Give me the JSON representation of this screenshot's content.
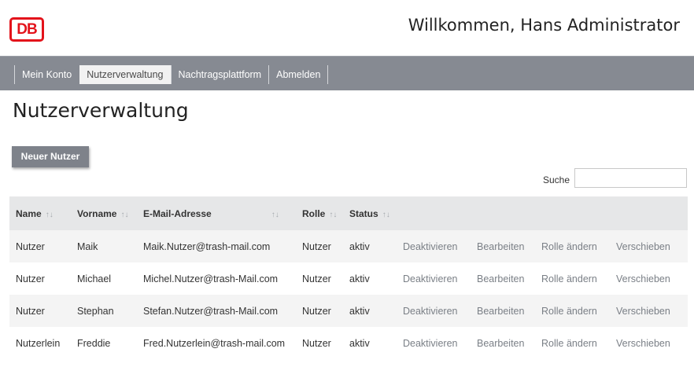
{
  "header": {
    "logo_text": "DB",
    "brand_color": "#e3131b",
    "welcome": "Willkommen, Hans Administrator"
  },
  "nav": {
    "items": [
      {
        "label": "Mein Konto"
      },
      {
        "label": "Nutzerverwaltung",
        "active": true
      },
      {
        "label": "Nachtragsplattform"
      },
      {
        "label": "Abmelden"
      }
    ],
    "background": "#868a92"
  },
  "page": {
    "title": "Nutzerverwaltung",
    "new_user_button": "Neuer Nutzer",
    "search_label": "Suche",
    "search_value": ""
  },
  "table": {
    "columns": [
      "Name",
      "Vorname",
      "E-Mail-Adresse",
      "Rolle",
      "Status"
    ],
    "sort_icon": "sort-arrows-icon",
    "rows": [
      {
        "name": "Nutzer",
        "vorname": "Maik",
        "email": "Maik.Nutzer@trash-mail.com",
        "rolle": "Nutzer",
        "status": "aktiv",
        "actions": [
          "Deaktivieren",
          "Bearbeiten",
          "Rolle ändern",
          "Verschieben"
        ]
      },
      {
        "name": "Nutzer",
        "vorname": "Michael",
        "email": "Michel.Nutzer@trash-Mail.com",
        "rolle": "Nutzer",
        "status": "aktiv",
        "actions": [
          "Deaktivieren",
          "Bearbeiten",
          "Rolle ändern",
          "Verschieben"
        ]
      },
      {
        "name": "Nutzer",
        "vorname": "Stephan",
        "email": "Stefan.Nutzer@trash-Mail.com",
        "rolle": "Nutzer",
        "status": "aktiv",
        "actions": [
          "Deaktivieren",
          "Bearbeiten",
          "Rolle ändern",
          "Verschieben"
        ]
      },
      {
        "name": "Nutzerlein",
        "vorname": "Freddie",
        "email": "Fred.Nutzerlein@trash-mail.com",
        "rolle": "Nutzer",
        "status": "aktiv",
        "actions": [
          "Deaktivieren",
          "Bearbeiten",
          "Rolle ändern",
          "Verschieben"
        ]
      }
    ]
  }
}
